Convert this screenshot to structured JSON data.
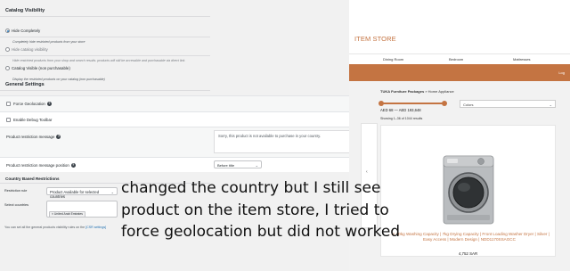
{
  "settings": {
    "catalog_visibility": {
      "title": "Catalog Visibility",
      "options": [
        {
          "label": "Hide Completely",
          "desc": "Completely hide restricted products from your store",
          "selected": true
        },
        {
          "label": "Hide catalog visibility",
          "desc": "Hide restricted products from your shop and search results. products will still be accessible and purchasable via direct link.",
          "selected": false
        },
        {
          "label": "Catalog Visible (non purchasable)",
          "desc": "Display the restricted products on your catalog (non purchasable)",
          "selected": false
        }
      ]
    },
    "general": {
      "title": "General Settings",
      "force_geolocation_label": "Force Geolocation",
      "debug_toolbar_label": "Enable Debug Toolbar",
      "message_label": "Product restriction message",
      "message_value": "Sorry, this product is not available to purchase in your country.",
      "position_label": "Product restriction message position",
      "position_value": "Before title"
    },
    "country": {
      "title": "Country Based Restrictions",
      "rule_label": "Restriction rule",
      "rule_value": "Product Available for selected countries",
      "countries_label": "Select countries",
      "countries": [
        "× United Arab Emirates"
      ]
    },
    "footer_note_prefix": "You can set all the general products visibility rules on the",
    "footer_note_link": "[CSR settings]"
  },
  "store": {
    "title": "ITEM STORE",
    "nav": [
      "Dining Room",
      "Bedroom",
      "Mattresses"
    ],
    "banner_link": "Log",
    "breadcrumb_bold": "TUKA Furniture Packages",
    "breadcrumb_rest": " » Home Appliance",
    "price_range": "AED 68 — AED 193,648",
    "filter_placeholder": "Colors",
    "showing": "Showing 1–36 of 1044 results",
    "arrow": "‹",
    "product_title": "...n 10kg Washing Capacity | 7kg Drying Capacity | Front Loading Washer Dryer | Silver | Easy Access | Modern Design | NDD1170SSAGCC",
    "product_price": "4,752 SAR",
    "accent_color": "#c47442"
  },
  "caption": {
    "lines": [
      "changed the country but I still see",
      "product on the item store, I tried to",
      "force geolocation but did not worked"
    ]
  },
  "icons": {
    "help": "?",
    "caret": "⌄"
  }
}
